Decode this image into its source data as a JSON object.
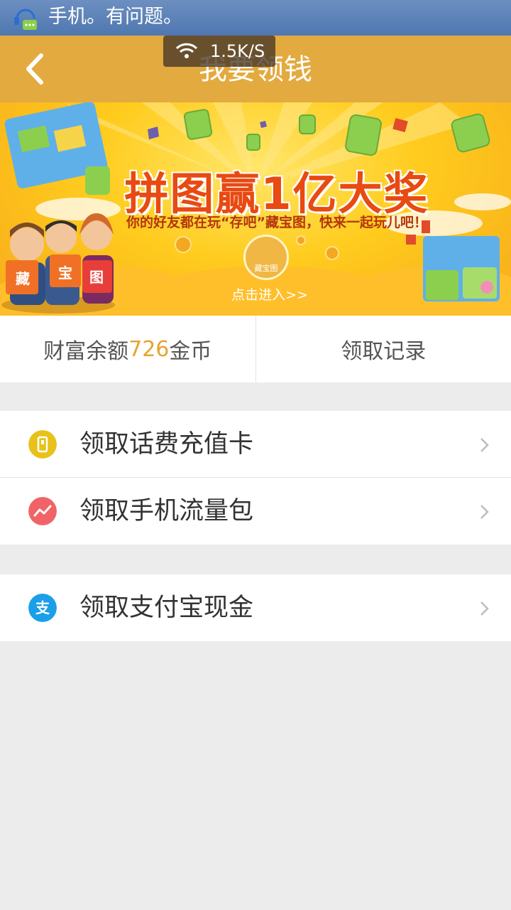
{
  "status_bar": {
    "notification_text": "手机。有问题。"
  },
  "header": {
    "title": "我要领钱",
    "speed_text": "1.5K/S"
  },
  "banner": {
    "headline": "拼图赢1亿大奖",
    "subline": "你的好友都在玩“存吧”藏宝图，快来一起玩儿吧！",
    "badge_text": "藏宝图",
    "enter_text": "点击进入>>",
    "character_signs": [
      "藏",
      "宝",
      "图"
    ]
  },
  "wealth": {
    "prefix": "财富余额",
    "amount": "726",
    "suffix": "金币",
    "record_label": "领取记录"
  },
  "menu": {
    "items": [
      {
        "label": "领取话费充值卡",
        "icon": "phone-card-icon",
        "color": "#e8c21a"
      },
      {
        "label": "领取手机流量包",
        "icon": "data-trend-icon",
        "color": "#f06468"
      },
      {
        "label": "领取支付宝现金",
        "icon": "alipay-icon",
        "color": "#1a9fe8"
      }
    ]
  },
  "colors": {
    "header": "#e3aa3f",
    "status_bar": "#5a80b6",
    "highlight": "#e6a430"
  }
}
